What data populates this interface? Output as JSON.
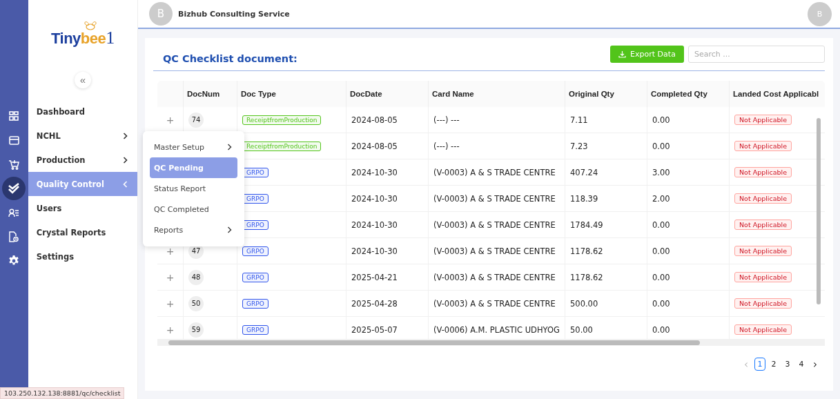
{
  "rail": [
    {
      "kind": "grid",
      "selected": false
    },
    {
      "kind": "card",
      "selected": false
    },
    {
      "kind": "cart",
      "selected": false
    },
    {
      "kind": "check",
      "selected": true
    },
    {
      "kind": "users",
      "selected": false
    },
    {
      "kind": "file",
      "selected": false
    },
    {
      "kind": "gear",
      "selected": false
    }
  ],
  "logo": [
    "Tiny",
    "bee",
    "1"
  ],
  "collapse": "«",
  "menu": [
    {
      "label": "Dashboard",
      "submenu": false,
      "selected": false
    },
    {
      "label": "NCHL",
      "submenu": true,
      "expanded": false,
      "selected": false
    },
    {
      "label": "Production",
      "submenu": true,
      "expanded": false,
      "selected": false
    },
    {
      "label": "Quality Control",
      "submenu": true,
      "expanded": true,
      "selected": true
    },
    {
      "label": "Users",
      "submenu": false,
      "selected": false
    },
    {
      "label": "Crystal Reports",
      "submenu": false,
      "selected": false
    },
    {
      "label": "Settings",
      "submenu": false,
      "selected": false
    }
  ],
  "popup": [
    {
      "label": "Master Setup",
      "submenu": true,
      "selected": false
    },
    {
      "label": "QC Pending",
      "submenu": false,
      "selected": true
    },
    {
      "label": "Status Report",
      "submenu": false,
      "selected": false
    },
    {
      "label": "QC Completed",
      "submenu": false,
      "selected": false
    },
    {
      "label": "Reports",
      "submenu": true,
      "selected": false
    }
  ],
  "header": {
    "avatar": "B",
    "company": "Bizhub Consulting Service",
    "user_avatar": "B"
  },
  "title": "QC Checklist document:",
  "export_button": "Export Data",
  "search": {
    "placeholder": "Search ..."
  },
  "table": {
    "columns": [
      "DocNum",
      "Doc Type",
      "DocDate",
      "Card Name",
      "Original Qty",
      "Completed Qty",
      "Landed Cost Applicabl"
    ],
    "rows": [
      {
        "expand": "+",
        "doc_num": "74",
        "doc_type": {
          "text": "ReceiptfromProduction",
          "color": "#52c41a"
        },
        "date": "2024-08-05",
        "card": "(---) ---",
        "orig": "7.11",
        "done": "0.00",
        "landed": "Not Applicable"
      },
      {
        "doc_type": {
          "text": "ReceiptfromProduction",
          "color": "#52c41a"
        },
        "date": "2024-08-05",
        "card": "(---) ---",
        "orig": "7.23",
        "done": "0.00",
        "landed": "Not Applicable"
      },
      {
        "doc_type": {
          "text": "GRPO",
          "color": "#2f54eb"
        },
        "date": "2024-10-30",
        "card": "(V-0003) A & S TRADE CENTRE",
        "orig": "407.24",
        "done": "3.00",
        "landed": "Not Applicable"
      },
      {
        "doc_type": {
          "text": "GRPO",
          "color": "#2f54eb"
        },
        "date": "2024-10-30",
        "card": "(V-0003) A & S TRADE CENTRE",
        "orig": "118.39",
        "done": "2.00",
        "landed": "Not Applicable"
      },
      {
        "doc_type": {
          "text": "GRPO",
          "color": "#2f54eb"
        },
        "date": "2024-10-30",
        "card": "(V-0003) A & S TRADE CENTRE",
        "orig": "1784.49",
        "done": "0.00",
        "landed": "Not Applicable"
      },
      {
        "expand": "+",
        "doc_num": "47",
        "doc_type": {
          "text": "GRPO",
          "color": "#2f54eb"
        },
        "date": "2024-10-30",
        "card": "(V-0003) A & S TRADE CENTRE",
        "orig": "1178.62",
        "done": "0.00",
        "landed": "Not Applicable"
      },
      {
        "expand": "+",
        "doc_num": "48",
        "doc_type": {
          "text": "GRPO",
          "color": "#2f54eb"
        },
        "date": "2025-04-21",
        "card": "(V-0003) A & S TRADE CENTRE",
        "orig": "1178.62",
        "done": "0.00",
        "landed": "Not Applicable"
      },
      {
        "expand": "+",
        "doc_num": "50",
        "doc_type": {
          "text": "GRPO",
          "color": "#2f54eb"
        },
        "date": "2025-04-28",
        "card": "(V-0003) A & S TRADE CENTRE",
        "orig": "500.00",
        "done": "0.00",
        "landed": "Not Applicable"
      },
      {
        "expand": "+",
        "doc_num": "59",
        "doc_type": {
          "text": "GRPO",
          "color": "#2f54eb"
        },
        "date": "2025-05-07",
        "card": "(V-0006) A.M. PLASTIC UDHYOG",
        "orig": "50.00",
        "done": "0.00",
        "landed": "Not Applicable"
      }
    ]
  },
  "pagination": {
    "prev": "‹",
    "next": "›",
    "prev_disabled": true,
    "pages": [
      {
        "label": "1",
        "selected": true
      },
      {
        "label": "2",
        "selected": false
      },
      {
        "label": "3",
        "selected": false
      },
      {
        "label": "4",
        "selected": false
      }
    ]
  },
  "status_url": "103.250.132.138:8881/qc/checklist"
}
